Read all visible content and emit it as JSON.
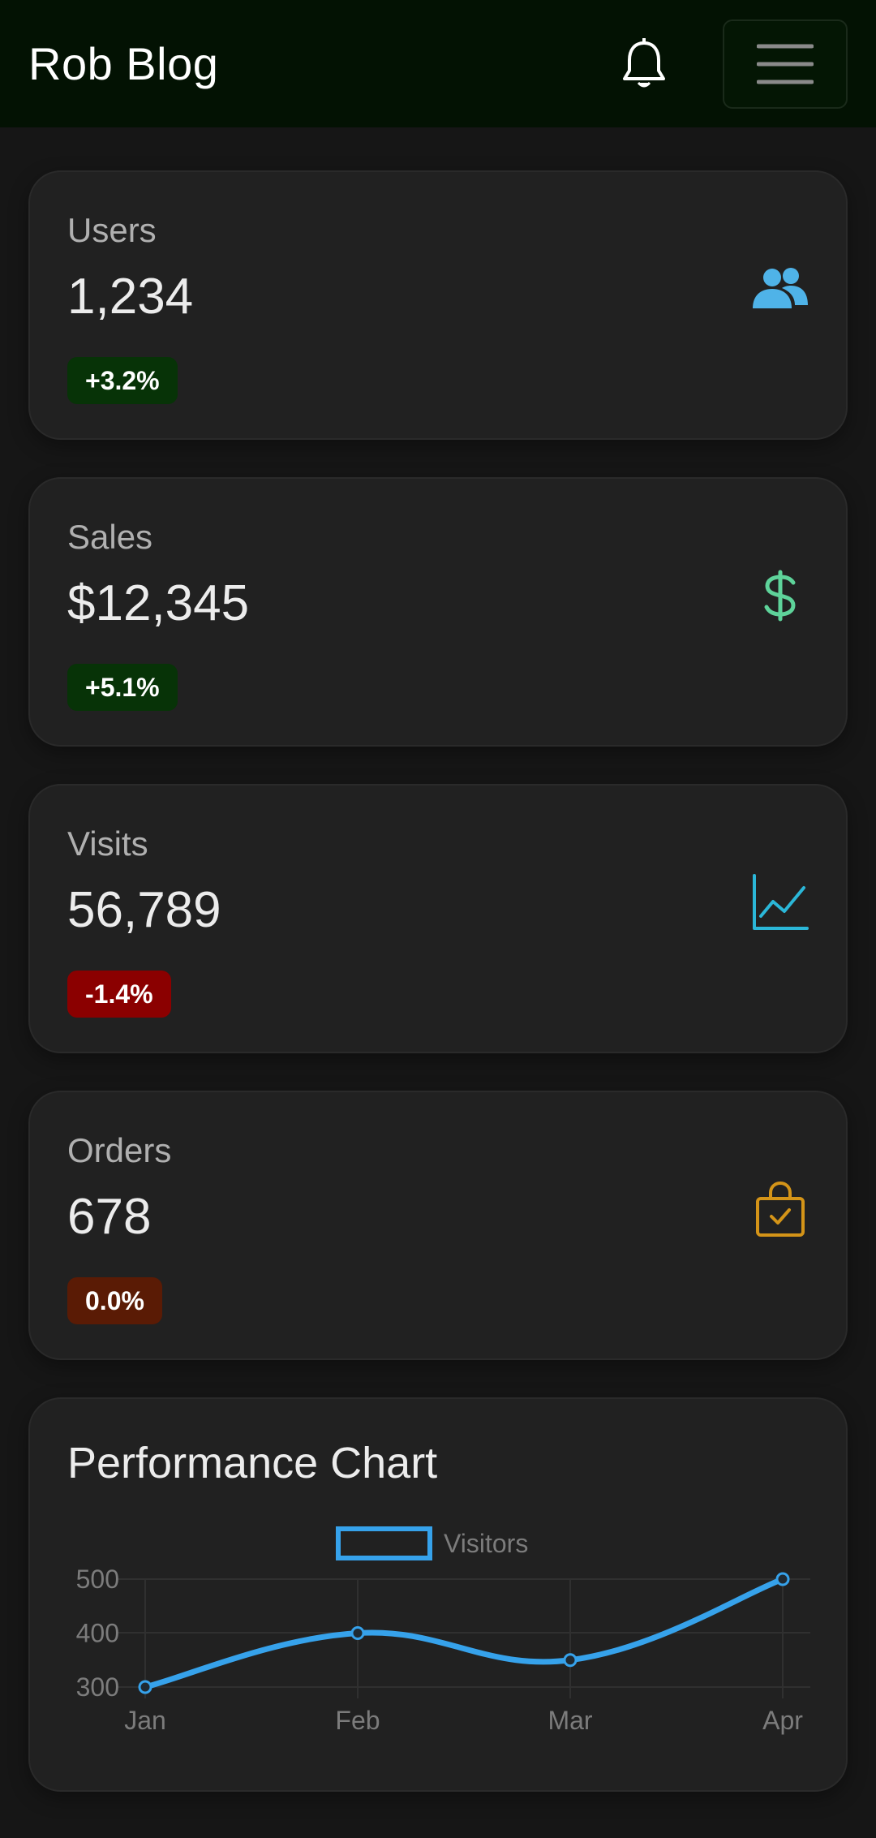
{
  "header": {
    "title": "Rob Blog",
    "icons": [
      "bell-icon",
      "hamburger-menu-icon"
    ]
  },
  "stats": [
    {
      "label": "Users",
      "value": "1,234",
      "change": "+3.2%",
      "trend": "up",
      "icon": "users-icon",
      "icon_color": "#4fb3e8",
      "badge_color": "#073307"
    },
    {
      "label": "Sales",
      "value": "$12,345",
      "change": "+5.1%",
      "trend": "up",
      "icon": "dollar-icon",
      "icon_color": "#5ed39a",
      "badge_color": "#073307"
    },
    {
      "label": "Visits",
      "value": "56,789",
      "change": "-1.4%",
      "trend": "down",
      "icon": "line-chart-icon",
      "icon_color": "#2bb7d8",
      "badge_color": "#8b0000"
    },
    {
      "label": "Orders",
      "value": "678",
      "change": "0.0%",
      "trend": "flat",
      "icon": "shopping-bag-icon",
      "icon_color": "#d49418",
      "badge_color": "#5a1b05"
    }
  ],
  "chart": {
    "title": "Performance Chart"
  },
  "chart_data": {
    "type": "line",
    "categories": [
      "Jan",
      "Feb",
      "Mar",
      "Apr"
    ],
    "series": [
      {
        "name": "Visitors",
        "values": [
          300,
          400,
          350,
          500
        ],
        "color": "#36a2eb"
      }
    ],
    "yticks": [
      300,
      400,
      500
    ],
    "ylim": [
      300,
      500
    ],
    "legend": "top",
    "grid": true,
    "smooth": true
  }
}
